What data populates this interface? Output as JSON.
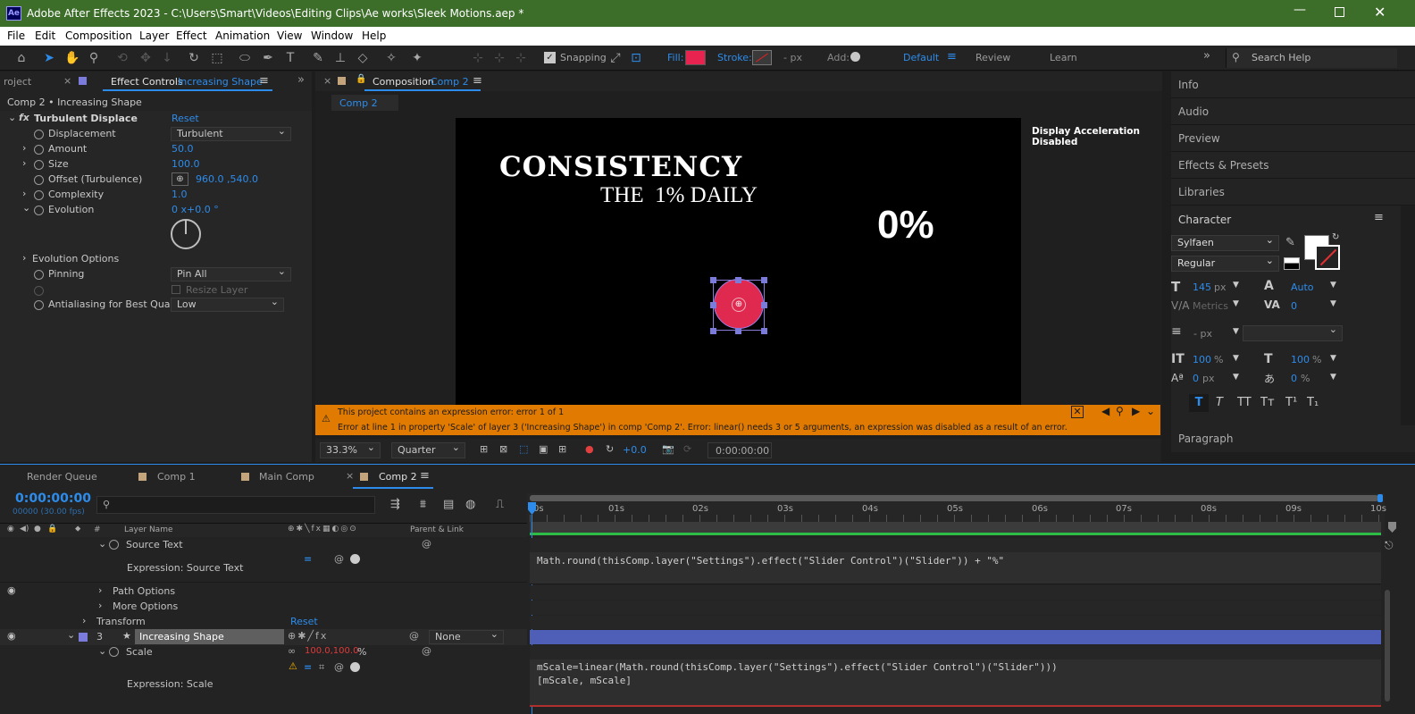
{
  "app": {
    "title": "Adobe After Effects 2023 - C:\\Users\\Smart\\Videos\\Editing Clips\\Ae works\\Sleek Motions.aep *",
    "logo": "Ae"
  },
  "menu": [
    "File",
    "Edit",
    "Composition",
    "Layer",
    "Effect",
    "Animation",
    "View",
    "Window",
    "Help"
  ],
  "toolbar": {
    "snapping": "Snapping",
    "fill": "Fill:",
    "stroke": "Stroke:",
    "px": "- px",
    "add": "Add:",
    "workspace_default": "Default",
    "review": "Review",
    "learn": "Learn",
    "search_placeholder": "Search Help",
    "fill_color": "#e8234f"
  },
  "left_panel": {
    "project_tab": "roject",
    "effect_tab": "Effect Controls",
    "effect_tab_layer": "Increasing Shape",
    "breadcrumb": "Comp 2 • Increasing Shape",
    "effect_name": "Turbulent Displace",
    "reset": "Reset",
    "props": [
      {
        "name": "Displacement",
        "value": "Turbulent"
      },
      {
        "name": "Amount",
        "value": "50.0"
      },
      {
        "name": "Size",
        "value": "100.0"
      },
      {
        "name": "Offset (Turbulence)",
        "value": "960.0 ,540.0"
      },
      {
        "name": "Complexity",
        "value": "1.0"
      },
      {
        "name": "Evolution",
        "value": "0 x+0.0 °"
      },
      {
        "name": "Evolution Options",
        "value": ""
      },
      {
        "name": "Pinning",
        "value": "Pin All"
      },
      {
        "name": "Resize Layer",
        "value": ""
      },
      {
        "name": "Antialiasing for Best Qualit",
        "value": "Low"
      }
    ]
  },
  "composition": {
    "tab_label": "Composition",
    "tab_comp": "Comp 2",
    "sub_tab": "Comp 2",
    "display_accel": "Display Acceleration Disabled",
    "canvas_text_1": "CONSISTENCY",
    "canvas_text_2": "THE  1% DAILY",
    "canvas_text_3": "0%",
    "circle_color": "#e0294e",
    "error_line_1": "This project contains an expression error: error 1 of 1",
    "error_line_2": "Error at line 1 in property 'Scale' of layer 3 ('Increasing Shape') in comp 'Comp 2'.  Error: linear() needs 3 or 5 arguments, an expression was disabled as a result of an error.",
    "zoom": "33.3%",
    "resolution": "Quarter",
    "exposure": "+0.0",
    "timecode": "0:00:00:00"
  },
  "right_panels": {
    "panels": [
      "Info",
      "Audio",
      "Preview",
      "Effects & Presets",
      "Libraries"
    ],
    "character": "Character",
    "font": "Sylfaen",
    "style": "Regular",
    "font_size": "145",
    "font_size_unit": "px",
    "leading": "Auto",
    "kerning": "Metrics",
    "tracking": "0",
    "stroke_width": "- px",
    "vscale": "100",
    "hscale": "100",
    "pct": "%",
    "baseline": "0",
    "baseline_unit": "px",
    "tsume": "0",
    "tsume_unit": "%",
    "paragraph": "Paragraph"
  },
  "timeline": {
    "tabs": [
      "Render Queue",
      "Comp 1",
      "Main Comp",
      "Comp 2"
    ],
    "timecode": "0:00:00:00",
    "frame": "00000 (30.00 fps)",
    "col_layer_name": "Layer Name",
    "col_parent": "Parent & Link",
    "ruler": [
      "0s",
      "01s",
      "02s",
      "03s",
      "04s",
      "05s",
      "06s",
      "07s",
      "08s",
      "09s",
      "10s"
    ],
    "rows": {
      "source_text": "Source Text",
      "expr_source_text": "Expression: Source Text",
      "path_options": "Path Options",
      "more_options": "More Options",
      "transform": "Transform",
      "reset": "Reset",
      "layer_num": "3",
      "layer_name": "Increasing Shape",
      "parent": "None",
      "scale": "Scale",
      "scale_value": "100.0,100.0",
      "scale_unit": "%",
      "expr_scale": "Expression: Scale"
    },
    "expr_1": "Math.round(thisComp.layer(\"Settings\").effect(\"Slider Control\")(\"Slider\")) + \"%\"",
    "expr_2": "mScale=linear(Math.round(thisComp.layer(\"Settings\").effect(\"Slider Control\")(\"Slider\")))",
    "expr_3": "[mScale, mScale]"
  }
}
